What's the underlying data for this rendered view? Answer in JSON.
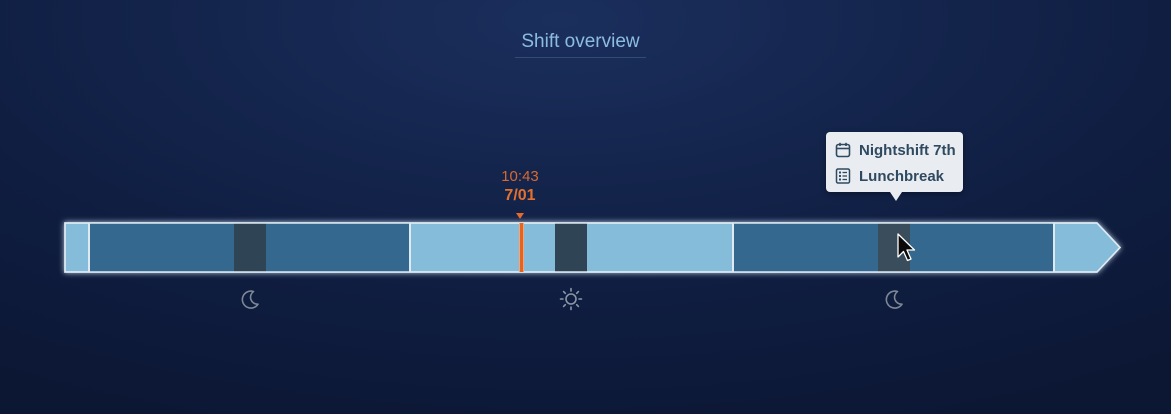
{
  "page": {
    "title": "Shift overview"
  },
  "now": {
    "time": "10:43",
    "date": "7/01"
  },
  "tooltip": {
    "shift_name": "Nightshift 7th",
    "break_name": "Lunchbreak",
    "shift_icon": "calendar-icon",
    "break_icon": "checklist-icon"
  },
  "shifts": [
    {
      "kind": "night",
      "icon": "moon-icon"
    },
    {
      "kind": "day",
      "icon": "sun-icon"
    },
    {
      "kind": "night",
      "icon": "moon-icon"
    }
  ],
  "colors": {
    "free_time": "#85bcda",
    "night_shift": "#34688f",
    "break": "#2f4556",
    "now_marker": "#e4651f",
    "title": "#8cbde0",
    "icon": "#8b96a6",
    "tooltip_bg": "#e9edf1"
  }
}
